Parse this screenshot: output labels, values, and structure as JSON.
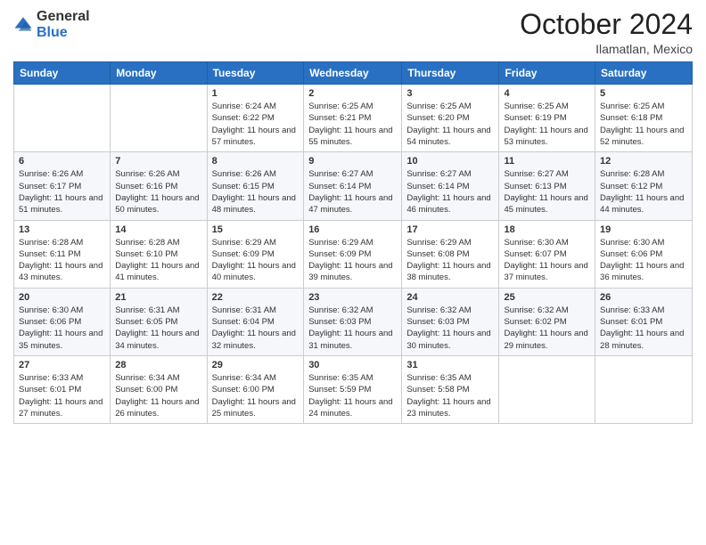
{
  "header": {
    "logo": {
      "line1": "General",
      "line2": "Blue"
    },
    "title": "October 2024",
    "subtitle": "Ilamatlan, Mexico"
  },
  "weekdays": [
    "Sunday",
    "Monday",
    "Tuesday",
    "Wednesday",
    "Thursday",
    "Friday",
    "Saturday"
  ],
  "weeks": [
    [
      {
        "day": "",
        "sunrise": "",
        "sunset": "",
        "daylight": ""
      },
      {
        "day": "",
        "sunrise": "",
        "sunset": "",
        "daylight": ""
      },
      {
        "day": "1",
        "sunrise": "Sunrise: 6:24 AM",
        "sunset": "Sunset: 6:22 PM",
        "daylight": "Daylight: 11 hours and 57 minutes."
      },
      {
        "day": "2",
        "sunrise": "Sunrise: 6:25 AM",
        "sunset": "Sunset: 6:21 PM",
        "daylight": "Daylight: 11 hours and 55 minutes."
      },
      {
        "day": "3",
        "sunrise": "Sunrise: 6:25 AM",
        "sunset": "Sunset: 6:20 PM",
        "daylight": "Daylight: 11 hours and 54 minutes."
      },
      {
        "day": "4",
        "sunrise": "Sunrise: 6:25 AM",
        "sunset": "Sunset: 6:19 PM",
        "daylight": "Daylight: 11 hours and 53 minutes."
      },
      {
        "day": "5",
        "sunrise": "Sunrise: 6:25 AM",
        "sunset": "Sunset: 6:18 PM",
        "daylight": "Daylight: 11 hours and 52 minutes."
      }
    ],
    [
      {
        "day": "6",
        "sunrise": "Sunrise: 6:26 AM",
        "sunset": "Sunset: 6:17 PM",
        "daylight": "Daylight: 11 hours and 51 minutes."
      },
      {
        "day": "7",
        "sunrise": "Sunrise: 6:26 AM",
        "sunset": "Sunset: 6:16 PM",
        "daylight": "Daylight: 11 hours and 50 minutes."
      },
      {
        "day": "8",
        "sunrise": "Sunrise: 6:26 AM",
        "sunset": "Sunset: 6:15 PM",
        "daylight": "Daylight: 11 hours and 48 minutes."
      },
      {
        "day": "9",
        "sunrise": "Sunrise: 6:27 AM",
        "sunset": "Sunset: 6:14 PM",
        "daylight": "Daylight: 11 hours and 47 minutes."
      },
      {
        "day": "10",
        "sunrise": "Sunrise: 6:27 AM",
        "sunset": "Sunset: 6:14 PM",
        "daylight": "Daylight: 11 hours and 46 minutes."
      },
      {
        "day": "11",
        "sunrise": "Sunrise: 6:27 AM",
        "sunset": "Sunset: 6:13 PM",
        "daylight": "Daylight: 11 hours and 45 minutes."
      },
      {
        "day": "12",
        "sunrise": "Sunrise: 6:28 AM",
        "sunset": "Sunset: 6:12 PM",
        "daylight": "Daylight: 11 hours and 44 minutes."
      }
    ],
    [
      {
        "day": "13",
        "sunrise": "Sunrise: 6:28 AM",
        "sunset": "Sunset: 6:11 PM",
        "daylight": "Daylight: 11 hours and 43 minutes."
      },
      {
        "day": "14",
        "sunrise": "Sunrise: 6:28 AM",
        "sunset": "Sunset: 6:10 PM",
        "daylight": "Daylight: 11 hours and 41 minutes."
      },
      {
        "day": "15",
        "sunrise": "Sunrise: 6:29 AM",
        "sunset": "Sunset: 6:09 PM",
        "daylight": "Daylight: 11 hours and 40 minutes."
      },
      {
        "day": "16",
        "sunrise": "Sunrise: 6:29 AM",
        "sunset": "Sunset: 6:09 PM",
        "daylight": "Daylight: 11 hours and 39 minutes."
      },
      {
        "day": "17",
        "sunrise": "Sunrise: 6:29 AM",
        "sunset": "Sunset: 6:08 PM",
        "daylight": "Daylight: 11 hours and 38 minutes."
      },
      {
        "day": "18",
        "sunrise": "Sunrise: 6:30 AM",
        "sunset": "Sunset: 6:07 PM",
        "daylight": "Daylight: 11 hours and 37 minutes."
      },
      {
        "day": "19",
        "sunrise": "Sunrise: 6:30 AM",
        "sunset": "Sunset: 6:06 PM",
        "daylight": "Daylight: 11 hours and 36 minutes."
      }
    ],
    [
      {
        "day": "20",
        "sunrise": "Sunrise: 6:30 AM",
        "sunset": "Sunset: 6:06 PM",
        "daylight": "Daylight: 11 hours and 35 minutes."
      },
      {
        "day": "21",
        "sunrise": "Sunrise: 6:31 AM",
        "sunset": "Sunset: 6:05 PM",
        "daylight": "Daylight: 11 hours and 34 minutes."
      },
      {
        "day": "22",
        "sunrise": "Sunrise: 6:31 AM",
        "sunset": "Sunset: 6:04 PM",
        "daylight": "Daylight: 11 hours and 32 minutes."
      },
      {
        "day": "23",
        "sunrise": "Sunrise: 6:32 AM",
        "sunset": "Sunset: 6:03 PM",
        "daylight": "Daylight: 11 hours and 31 minutes."
      },
      {
        "day": "24",
        "sunrise": "Sunrise: 6:32 AM",
        "sunset": "Sunset: 6:03 PM",
        "daylight": "Daylight: 11 hours and 30 minutes."
      },
      {
        "day": "25",
        "sunrise": "Sunrise: 6:32 AM",
        "sunset": "Sunset: 6:02 PM",
        "daylight": "Daylight: 11 hours and 29 minutes."
      },
      {
        "day": "26",
        "sunrise": "Sunrise: 6:33 AM",
        "sunset": "Sunset: 6:01 PM",
        "daylight": "Daylight: 11 hours and 28 minutes."
      }
    ],
    [
      {
        "day": "27",
        "sunrise": "Sunrise: 6:33 AM",
        "sunset": "Sunset: 6:01 PM",
        "daylight": "Daylight: 11 hours and 27 minutes."
      },
      {
        "day": "28",
        "sunrise": "Sunrise: 6:34 AM",
        "sunset": "Sunset: 6:00 PM",
        "daylight": "Daylight: 11 hours and 26 minutes."
      },
      {
        "day": "29",
        "sunrise": "Sunrise: 6:34 AM",
        "sunset": "Sunset: 6:00 PM",
        "daylight": "Daylight: 11 hours and 25 minutes."
      },
      {
        "day": "30",
        "sunrise": "Sunrise: 6:35 AM",
        "sunset": "Sunset: 5:59 PM",
        "daylight": "Daylight: 11 hours and 24 minutes."
      },
      {
        "day": "31",
        "sunrise": "Sunrise: 6:35 AM",
        "sunset": "Sunset: 5:58 PM",
        "daylight": "Daylight: 11 hours and 23 minutes."
      },
      {
        "day": "",
        "sunrise": "",
        "sunset": "",
        "daylight": ""
      },
      {
        "day": "",
        "sunrise": "",
        "sunset": "",
        "daylight": ""
      }
    ]
  ]
}
